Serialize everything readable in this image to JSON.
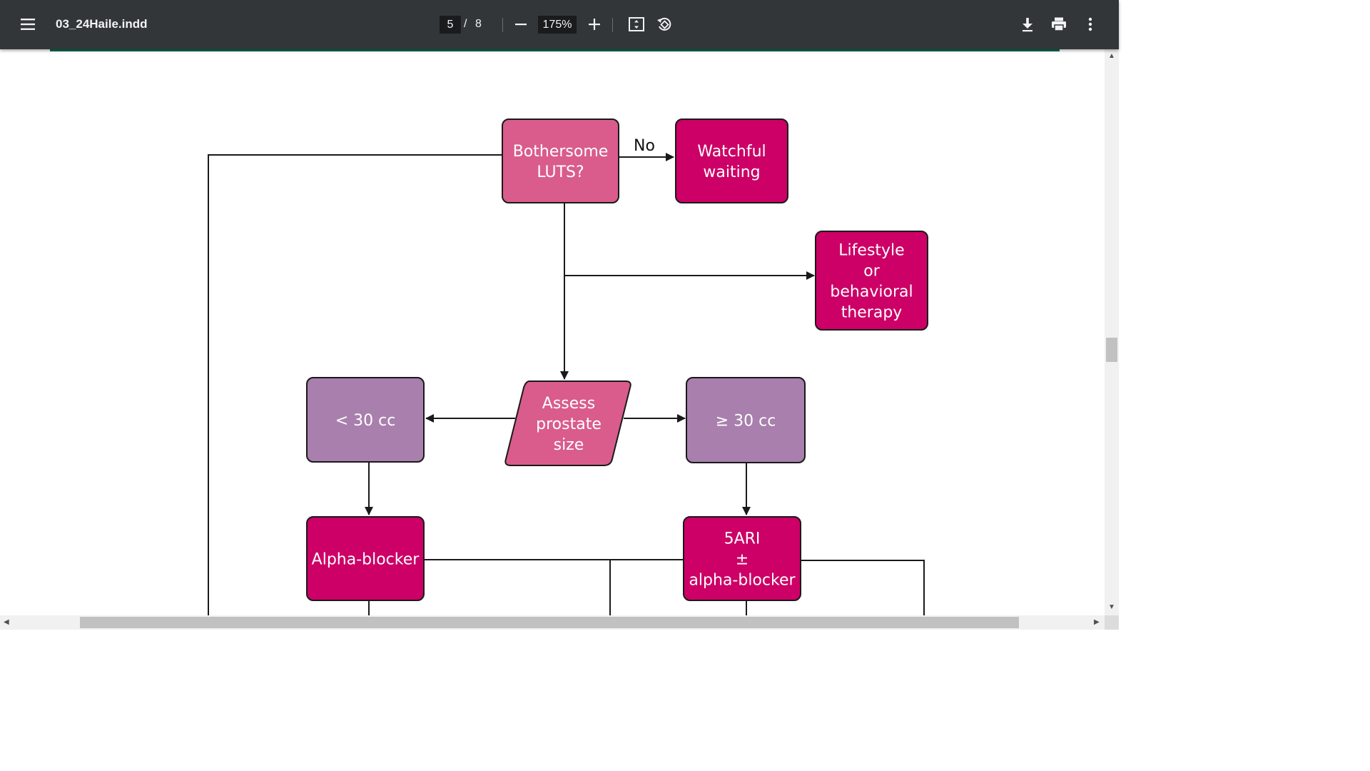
{
  "toolbar": {
    "menu_icon": "hamburger-menu-icon",
    "title": "03_24Haile.indd",
    "current_page": "5",
    "page_separator": "/",
    "total_pages": "8",
    "zoom": "175%",
    "icons": [
      "zoom-out-icon",
      "zoom-in-icon",
      "fit-page-icon",
      "rotate-icon",
      "download-icon",
      "print-icon",
      "more-vert-icon"
    ]
  },
  "colors": {
    "toolbar_bg": "#323639",
    "accent_green": "#006a4e",
    "magenta": "#cc0066",
    "pink": "#d95c8c",
    "purple": "#a87fad"
  },
  "diagram": {
    "nodes": {
      "bothersome": [
        "Bothersome",
        "LUTS?"
      ],
      "watchful": [
        "Watchful",
        "waiting"
      ],
      "lifestyle": [
        "Lifestyle",
        "or",
        "behavioral",
        "therapy"
      ],
      "assess": [
        "Assess",
        "prostate",
        "size"
      ],
      "less30": [
        "< 30 cc"
      ],
      "more30": [
        "≥ 30 cc"
      ],
      "alpha": [
        "Alpha-blocker"
      ],
      "fiveari": [
        "5ARI",
        "±",
        "alpha-blocker"
      ]
    },
    "edge_labels": {
      "no": "No"
    }
  }
}
